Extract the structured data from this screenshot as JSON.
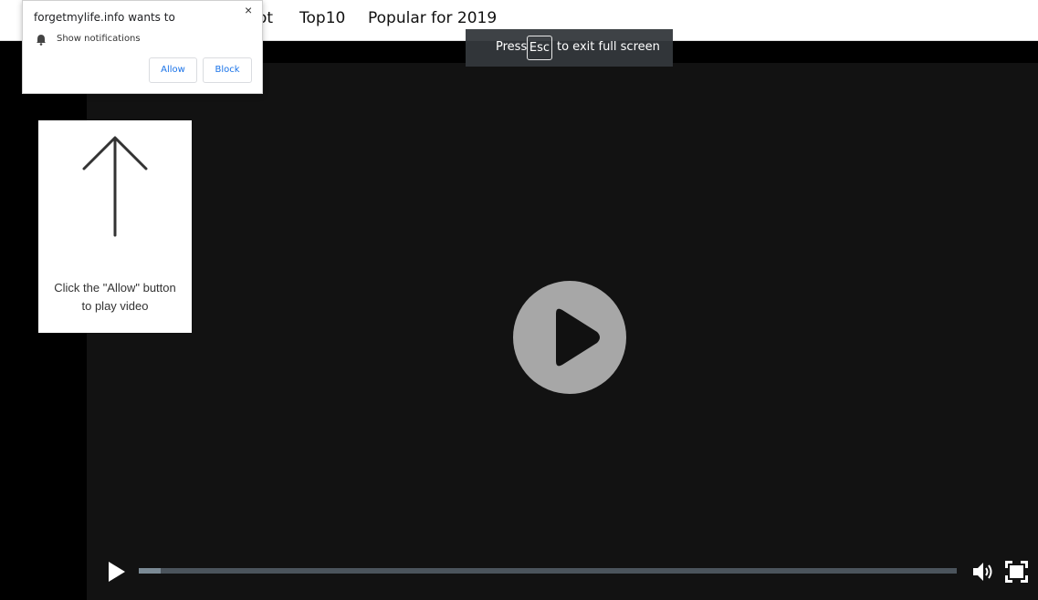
{
  "nav": {
    "items": [
      {
        "label": "ot"
      },
      {
        "label": "Top10"
      },
      {
        "label": "Popular for 2019"
      }
    ]
  },
  "fullscreen_notice": {
    "prefix": "Press",
    "key": "Esc",
    "suffix": "to exit full screen"
  },
  "hint_card": {
    "line1": "Click the \"Allow\" button",
    "line2": "to play video",
    "icon": "up-arrow-icon"
  },
  "permission_popup": {
    "title": "forgetmylife.info wants to",
    "close_glyph": "×",
    "permission_label": "Show notifications",
    "allow_label": "Allow",
    "block_label": "Block"
  },
  "player": {
    "progress_fraction": 0.027,
    "icons": [
      "play-icon",
      "volume-icon",
      "fullscreen-icon"
    ]
  },
  "colors": {
    "video_bg": "#121212",
    "big_play_bg": "#a7a7a7",
    "progress_track": "#4b545c",
    "progress_fill": "#7b8a95",
    "link_blue": "#1a73e8"
  }
}
